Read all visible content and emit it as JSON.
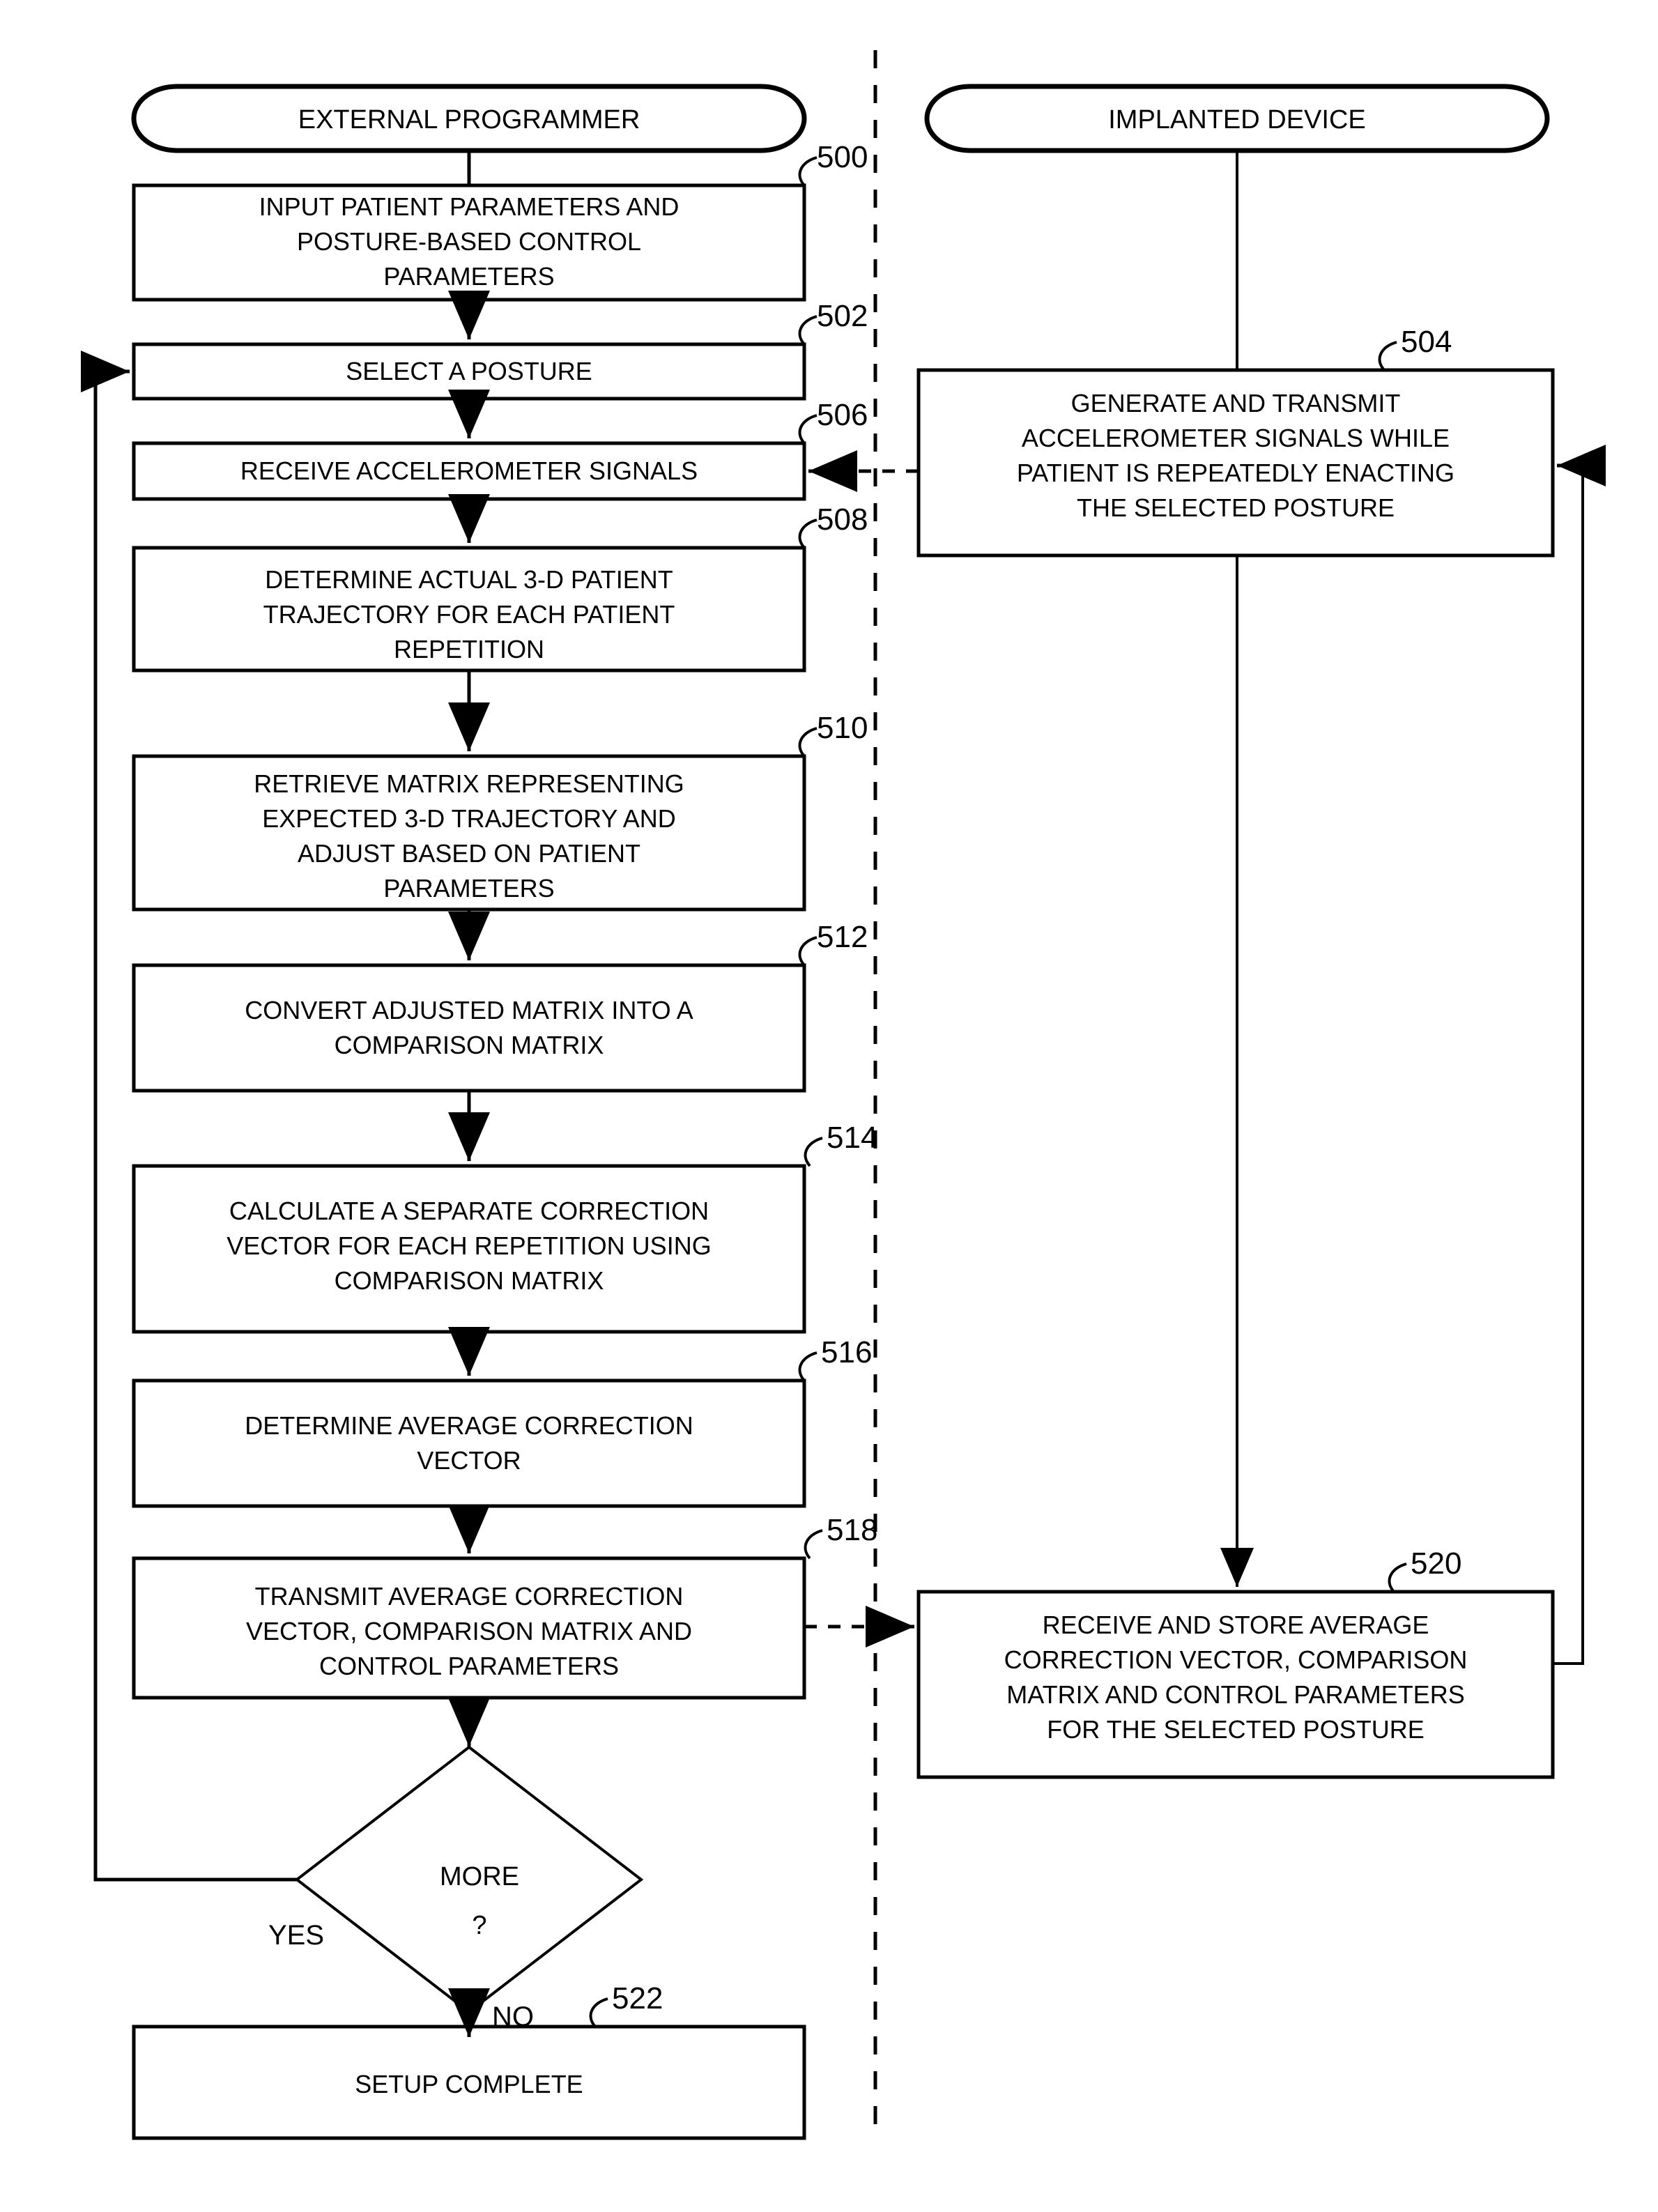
{
  "diagram": {
    "type": "flowchart",
    "lanes": [
      {
        "id": "external-programmer",
        "title": "EXTERNAL PROGRAMMER"
      },
      {
        "id": "implanted-device",
        "title": "IMPLANTED DEVICE"
      }
    ],
    "terminators": [
      {
        "id": "term-external",
        "label": "EXTERNAL PROGRAMMER"
      },
      {
        "id": "term-implanted",
        "label": "IMPLANTED DEVICE"
      }
    ],
    "nodes": [
      {
        "ref": "500",
        "lane": "external-programmer",
        "lines": [
          "INPUT PATIENT PARAMETERS AND",
          "POSTURE-BASED CONTROL",
          "PARAMETERS"
        ]
      },
      {
        "ref": "502",
        "lane": "external-programmer",
        "lines": [
          "SELECT A POSTURE"
        ]
      },
      {
        "ref": "506",
        "lane": "external-programmer",
        "lines": [
          "RECEIVE ACCELEROMETER SIGNALS"
        ]
      },
      {
        "ref": "508",
        "lane": "external-programmer",
        "lines": [
          "DETERMINE ACTUAL 3-D PATIENT",
          "TRAJECTORY FOR EACH PATIENT",
          "REPETITION"
        ]
      },
      {
        "ref": "510",
        "lane": "external-programmer",
        "lines": [
          "RETRIEVE MATRIX REPRESENTING",
          "EXPECTED 3-D TRAJECTORY AND",
          "ADJUST BASED ON PATIENT",
          "PARAMETERS"
        ]
      },
      {
        "ref": "512",
        "lane": "external-programmer",
        "lines": [
          "CONVERT ADJUSTED MATRIX INTO A",
          "COMPARISON MATRIX"
        ]
      },
      {
        "ref": "514",
        "lane": "external-programmer",
        "lines": [
          "CALCULATE A SEPARATE CORRECTION",
          "VECTOR FOR EACH REPETITION USING",
          "COMPARISON MATRIX"
        ]
      },
      {
        "ref": "516",
        "lane": "external-programmer",
        "lines": [
          "DETERMINE AVERAGE CORRECTION",
          "VECTOR"
        ]
      },
      {
        "ref": "518",
        "lane": "external-programmer",
        "lines": [
          "TRANSMIT AVERAGE CORRECTION",
          "VECTOR, COMPARISON  MATRIX AND",
          "CONTROL PARAMETERS"
        ]
      },
      {
        "ref": "522",
        "lane": "external-programmer",
        "lines": [
          "SETUP COMPLETE"
        ]
      },
      {
        "ref": "504",
        "lane": "implanted-device",
        "lines": [
          "GENERATE AND TRANSMIT",
          "ACCELEROMETER SIGNALS WHILE",
          "PATIENT IS REPEATEDLY ENACTING",
          "THE SELECTED POSTURE"
        ]
      },
      {
        "ref": "520",
        "lane": "implanted-device",
        "lines": [
          "RECEIVE AND STORE AVERAGE",
          "CORRECTION VECTOR, COMPARISON",
          "MATRIX AND CONTROL PARAMETERS",
          "FOR THE SELECTED POSTURE"
        ]
      }
    ],
    "decision": {
      "lines": [
        "MORE",
        "?"
      ],
      "branches": [
        {
          "label": "YES",
          "target_ref": "502"
        },
        {
          "label": "NO",
          "target_ref": "522"
        }
      ]
    },
    "reference_numerals": [
      "500",
      "502",
      "504",
      "506",
      "508",
      "510",
      "512",
      "514",
      "516",
      "518",
      "520",
      "522"
    ],
    "colors": {
      "line": "#000000",
      "background": "#ffffff",
      "text": "#000000"
    }
  }
}
